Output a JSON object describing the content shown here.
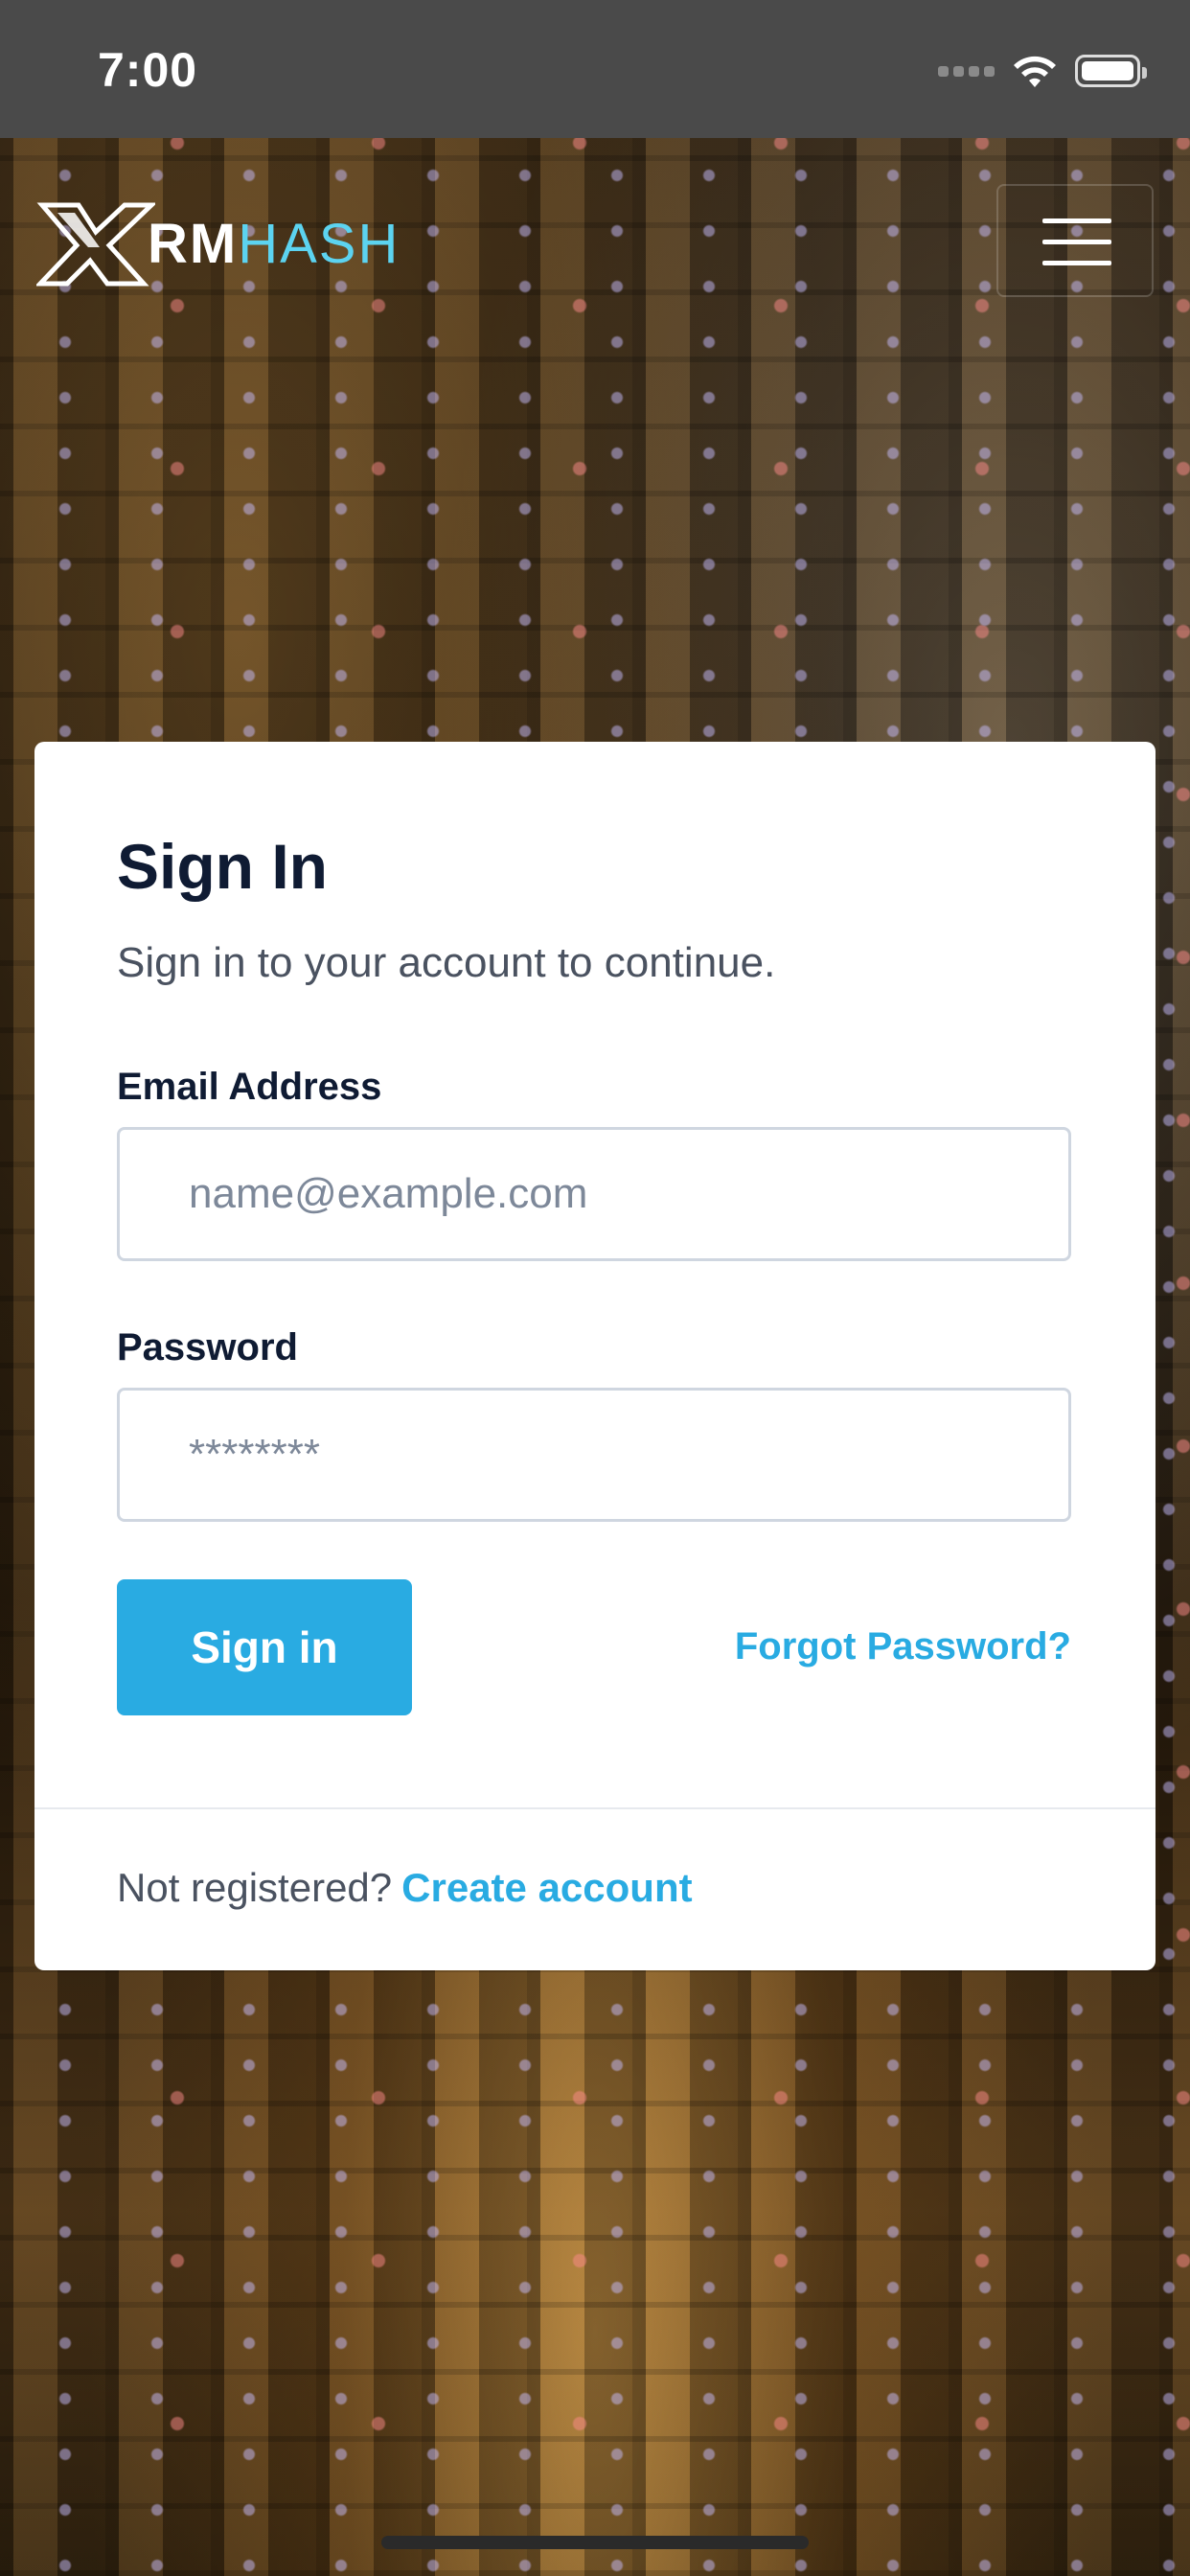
{
  "status_bar": {
    "time": "7:00"
  },
  "header": {
    "logo_part_1": "RM",
    "logo_part_2": "HASH"
  },
  "signin_form": {
    "title": "Sign In",
    "subtitle": "Sign in to your account to continue.",
    "email_label": "Email Address",
    "email_placeholder": "name@example.com",
    "email_value": "",
    "password_label": "Password",
    "password_placeholder": "********",
    "password_value": "",
    "submit_label": "Sign in",
    "forgot_label": "Forgot Password?",
    "not_registered_text": "Not registered?",
    "create_account_label": "Create account"
  },
  "colors": {
    "accent": "#29abe2",
    "logo_hash": "#5cd3f0",
    "heading": "#0f1b33",
    "status_bar": "#4a4a4a"
  },
  "icons": [
    "signal-icon",
    "wifi-icon",
    "battery-icon",
    "logo-x-icon",
    "hamburger-menu-icon"
  ]
}
